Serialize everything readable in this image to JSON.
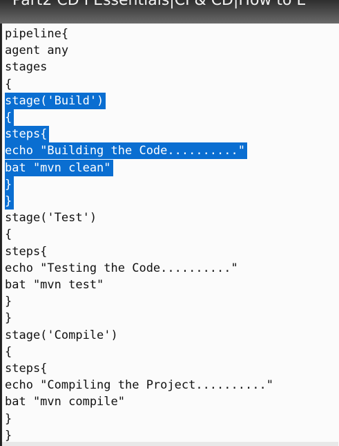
{
  "video": {
    "title": "Part2 CD I Essentials|CI & CD|How to E"
  },
  "editor": {
    "lines": [
      "pipeline{",
      "agent any",
      "stages",
      "{",
      "stage('Build')",
      "{",
      "steps{",
      "echo \"Building the Code..........\"",
      "bat \"mvn clean\"",
      "}",
      "}",
      "stage('Test')",
      "{",
      "steps{",
      "echo \"Testing the Code..........\"",
      "bat \"mvn test\"",
      "}",
      "}",
      "stage('Compile')",
      "{",
      "steps{",
      "echo \"Compiling the Project..........\"",
      "bat \"mvn compile\"",
      "}",
      "}"
    ],
    "selected_lines": [
      4,
      5,
      6,
      7,
      8,
      9,
      10
    ],
    "selection_color": "#0a6ed1"
  }
}
